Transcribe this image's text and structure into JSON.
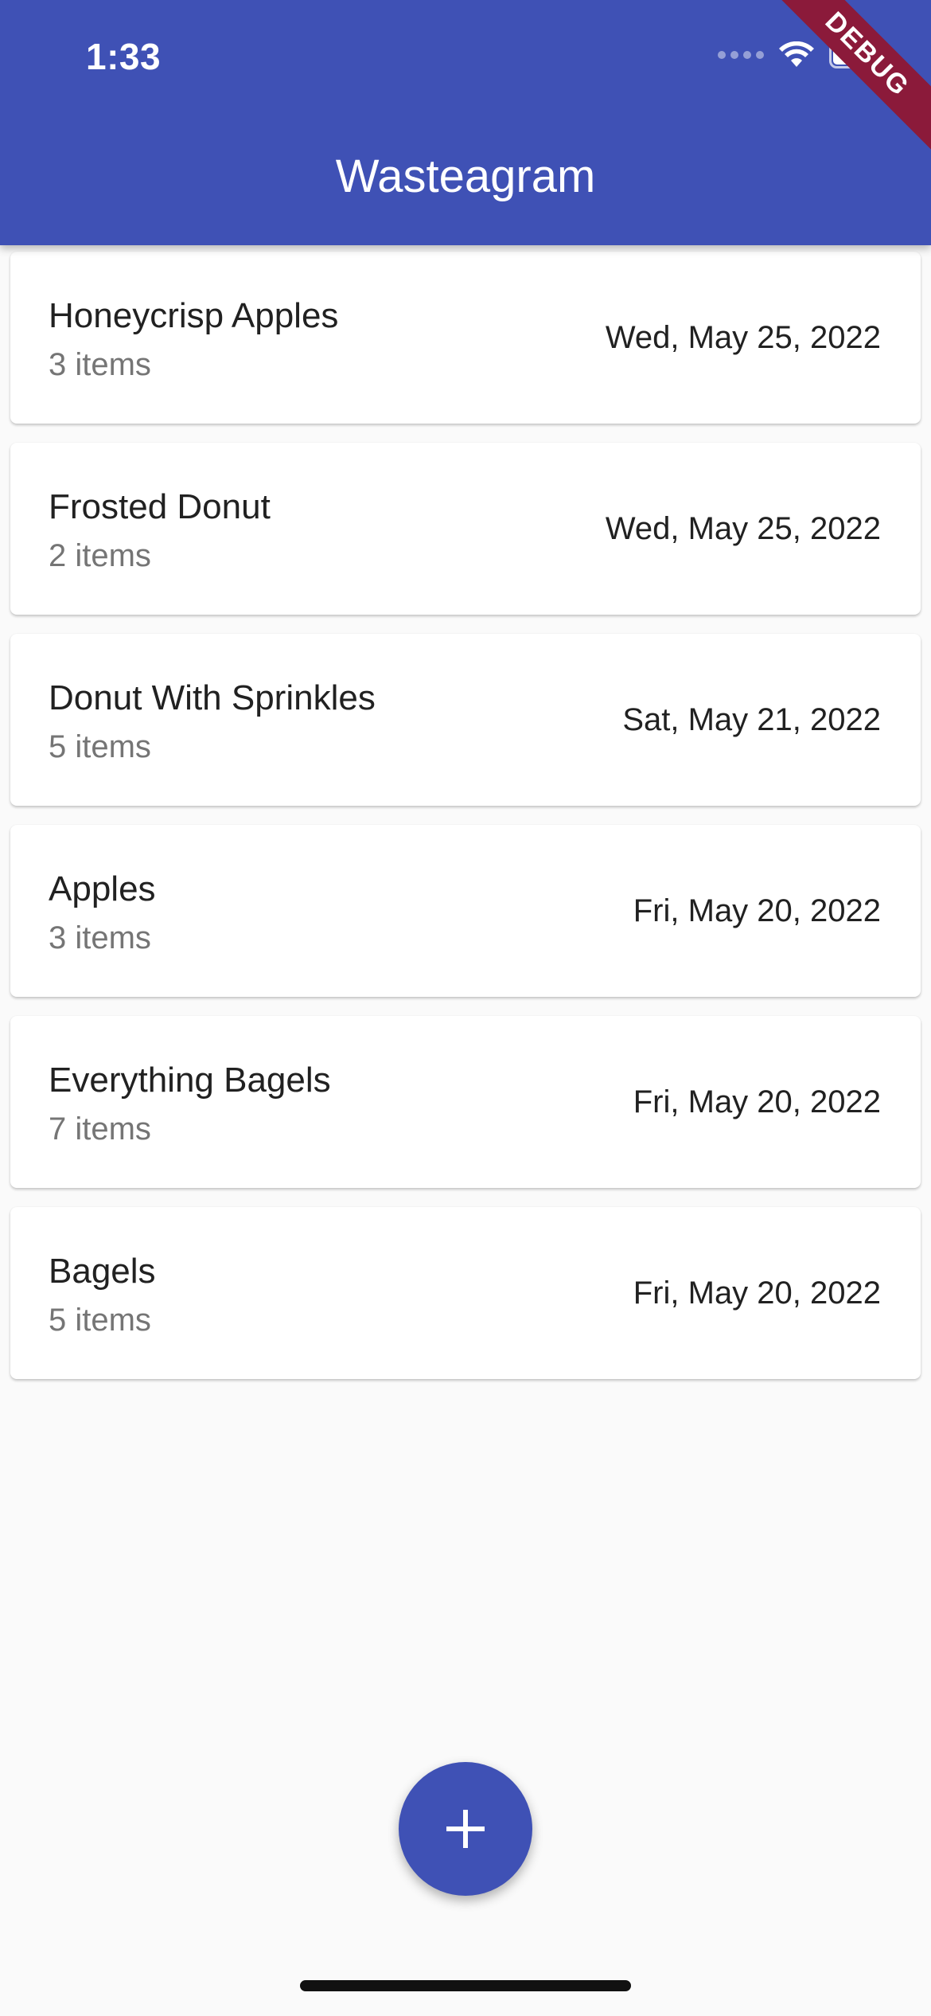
{
  "status_bar": {
    "time": "1:33"
  },
  "app_bar": {
    "title": "Wasteagram",
    "color": "#3F51B5"
  },
  "debug_banner": {
    "label": "DEBUG",
    "color": "#8B1A3A"
  },
  "entries": [
    {
      "title": "Honeycrisp Apples",
      "count": "3 items",
      "date": "Wed, May 25, 2022"
    },
    {
      "title": "Frosted Donut",
      "count": "2 items",
      "date": "Wed, May 25, 2022"
    },
    {
      "title": "Donut With Sprinkles",
      "count": "5 items",
      "date": "Sat, May 21, 2022"
    },
    {
      "title": "Apples",
      "count": "3 items",
      "date": "Fri, May 20, 2022"
    },
    {
      "title": "Everything Bagels",
      "count": "7 items",
      "date": "Fri, May 20, 2022"
    },
    {
      "title": "Bagels",
      "count": "5 items",
      "date": "Fri, May 20, 2022"
    }
  ],
  "fab": {
    "icon": "plus-icon"
  }
}
